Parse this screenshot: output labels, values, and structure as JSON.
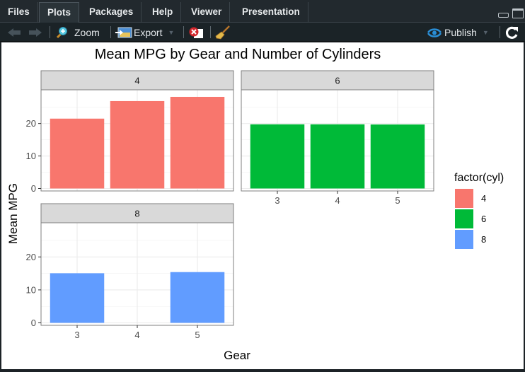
{
  "tabs": [
    {
      "label": "Files",
      "active": false
    },
    {
      "label": "Plots",
      "active": true
    },
    {
      "label": "Packages",
      "active": false
    },
    {
      "label": "Help",
      "active": false
    },
    {
      "label": "Viewer",
      "active": false
    },
    {
      "label": "Presentation",
      "active": false
    }
  ],
  "toolbar": {
    "back_icon": "arrow-left-icon",
    "forward_icon": "arrow-right-icon",
    "zoom_label": "Zoom",
    "export_label": "Export",
    "remove_icon": "remove-plot-icon",
    "clear_icon": "broom-icon",
    "publish_label": "Publish",
    "refresh_icon": "refresh-icon"
  },
  "colors": {
    "cyl4": "#F8766D",
    "cyl6": "#00BA38",
    "cyl8": "#619CFF",
    "strip_bg": "#D9D9D9",
    "grid": "#EBEBEB",
    "panel_border": "#7F7F7F"
  },
  "chart_data": {
    "type": "bar",
    "title": "Mean MPG by Gear and Number of Cylinders",
    "xlabel": "Gear",
    "ylabel": "Mean MPG",
    "facet_by": "cyl",
    "layout": "2x2 facet wrap",
    "categories": [
      "3",
      "4",
      "5"
    ],
    "ylim": [
      0,
      28.2
    ],
    "y_ticks": [
      0,
      10,
      20
    ],
    "grid": true,
    "legend": {
      "title": "factor(cyl)",
      "position": "right",
      "entries": [
        "4",
        "6",
        "8"
      ]
    },
    "series": [
      {
        "name": "4",
        "panel_label": "4",
        "values": [
          21.5,
          26.9,
          28.2
        ]
      },
      {
        "name": "6",
        "panel_label": "6",
        "values": [
          19.75,
          19.75,
          19.7
        ]
      },
      {
        "name": "8",
        "panel_label": "8",
        "values": [
          15.05,
          null,
          15.4
        ]
      }
    ]
  }
}
